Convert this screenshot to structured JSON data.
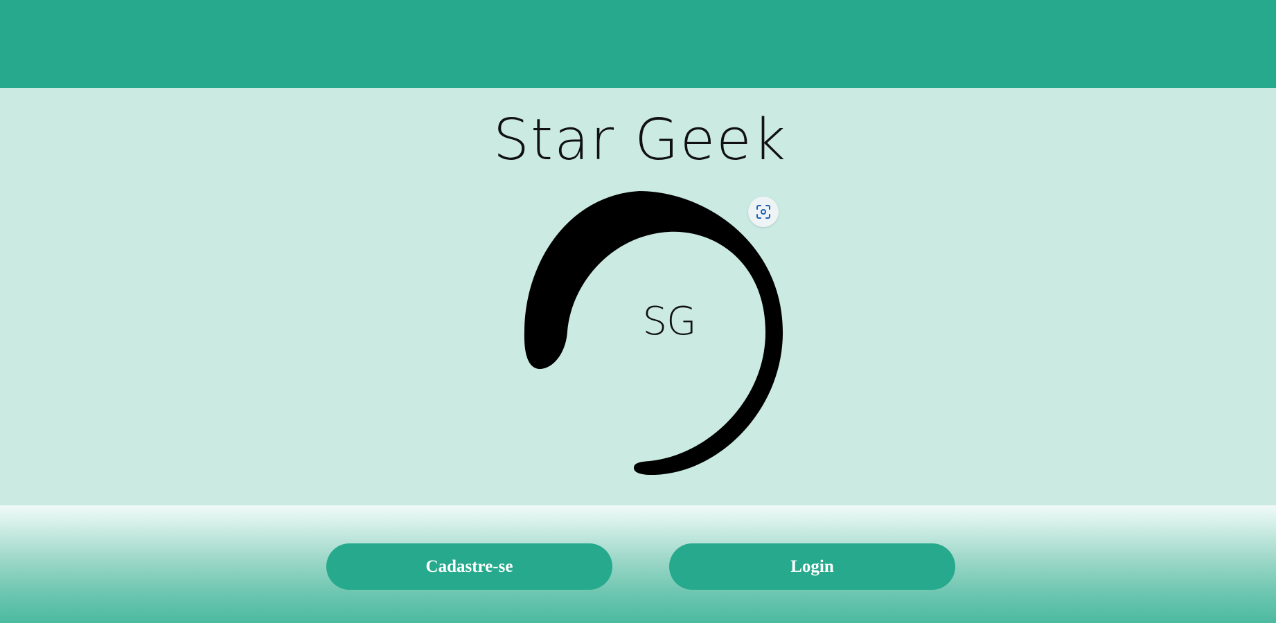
{
  "header": {
    "color": "#26a98c"
  },
  "main": {
    "title": "Star Geek",
    "logo": {
      "monogram": "SG",
      "icon": "crescent-swoosh-logo"
    },
    "lens_button": {
      "icon": "visual-search-icon"
    }
  },
  "footer": {
    "buttons": [
      {
        "label": "Cadastre-se"
      },
      {
        "label": "Login"
      }
    ]
  },
  "colors": {
    "accent": "#26a98c",
    "background": "#cbebe2",
    "text": "#111111"
  }
}
